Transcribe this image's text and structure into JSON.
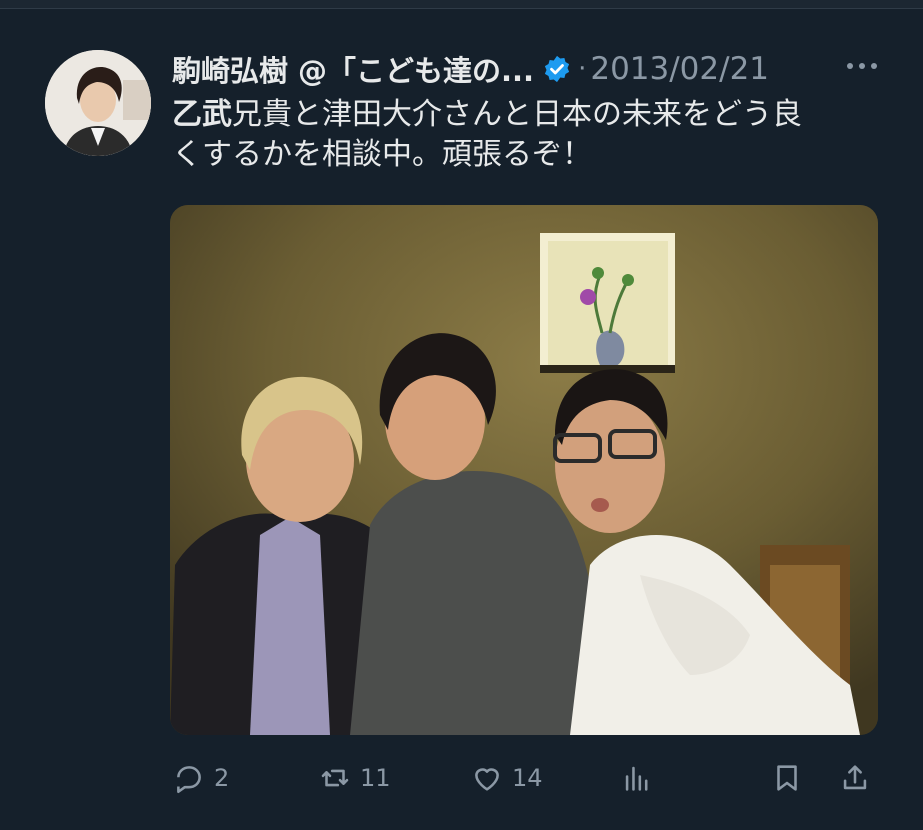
{
  "tweet": {
    "display_name": "駒崎弘樹",
    "handle": "@「こども達の...",
    "separator": "·",
    "date": "2013/02/21",
    "text_link": "乙武",
    "text_rest_line1": "兄貴と津田大介さんと日本の未来をどう良",
    "text_line2": "くするかを相談中。頑張るぞ！",
    "verified_color": "#1d9bf0"
  },
  "actions": {
    "reply_count": "2",
    "retweet_count": "11",
    "like_count": "14"
  },
  "icons": [
    "more-icon",
    "verified-badge-icon",
    "reply-icon",
    "retweet-icon",
    "like-icon",
    "views-icon",
    "bookmark-icon",
    "share-icon"
  ]
}
